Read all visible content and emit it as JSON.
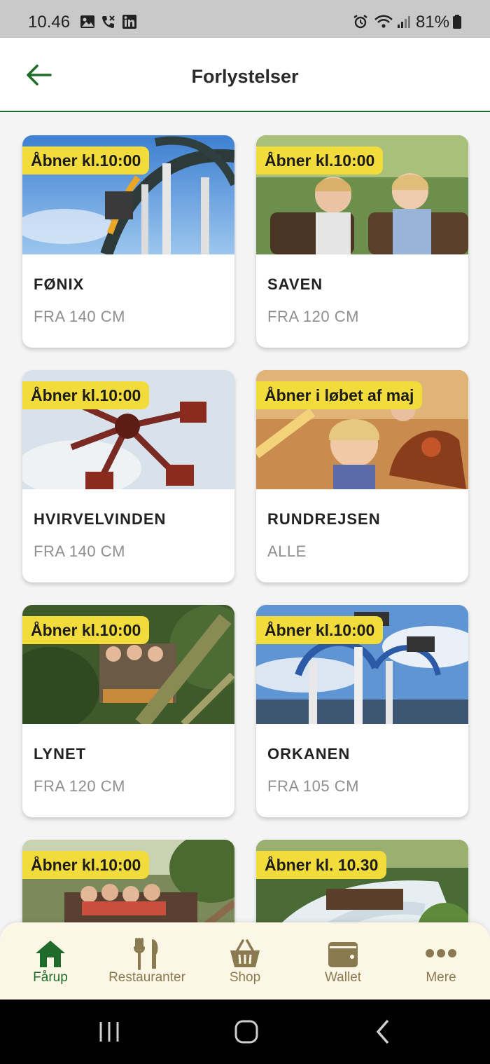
{
  "status_bar": {
    "time": "10.46",
    "battery": "81%"
  },
  "header": {
    "title": "Forlystelser"
  },
  "rides": [
    {
      "badge": "Åbner kl.10:00",
      "name": "FØNIX",
      "height": "FRA 140 CM",
      "photo_icon": "roller-coaster-photo"
    },
    {
      "badge": "Åbner kl.10:00",
      "name": "SAVEN",
      "height": "FRA 120 CM",
      "photo_icon": "kids-ride-photo"
    },
    {
      "badge": "Åbner kl.10:00",
      "name": "HVIRVELVINDEN",
      "height": "FRA 140 CM",
      "photo_icon": "pendulum-ride-photo"
    },
    {
      "badge": "Åbner i løbet af maj",
      "name": "RUNDREJSEN",
      "height": "ALLE",
      "photo_icon": "carousel-photo"
    },
    {
      "badge": "Åbner kl.10:00",
      "name": "LYNET",
      "height": "FRA 120 CM",
      "photo_icon": "wooden-coaster-photo"
    },
    {
      "badge": "Åbner kl.10:00",
      "name": "ORKANEN",
      "height": "FRA 105 CM",
      "photo_icon": "spinning-ride-photo"
    },
    {
      "badge": "Åbner kl.10:00",
      "name": "",
      "height": "",
      "photo_icon": "log-ride-photo"
    },
    {
      "badge": "Åbner kl. 10.30",
      "name": "",
      "height": "",
      "photo_icon": "water-splash-photo"
    }
  ],
  "tabs": [
    {
      "label": "Fårup",
      "icon": "home-icon",
      "active": true
    },
    {
      "label": "Restauranter",
      "icon": "fork-knife-icon",
      "active": false
    },
    {
      "label": "Shop",
      "icon": "basket-icon",
      "active": false
    },
    {
      "label": "Wallet",
      "icon": "wallet-icon",
      "active": false
    },
    {
      "label": "Mere",
      "icon": "more-dots-icon",
      "active": false
    }
  ],
  "colors": {
    "accent": "#1f6b2a",
    "badge": "#f2dc3c",
    "tab_inactive": "#8a7a50",
    "tabbar_bg": "#fbf6e6"
  }
}
